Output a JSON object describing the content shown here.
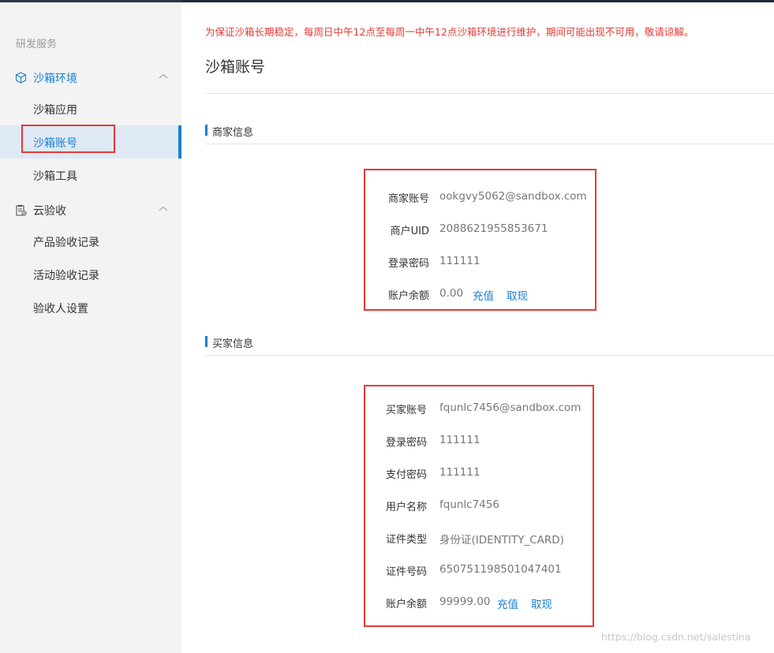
{
  "sidebar": {
    "section_title": "研发服务",
    "groups": [
      {
        "label": "沙箱环境",
        "icon": "cube-icon",
        "items": [
          {
            "label": "沙箱应用"
          },
          {
            "label": "沙箱账号"
          },
          {
            "label": "沙箱工具"
          }
        ]
      },
      {
        "label": "云验收",
        "icon": "clipboard-icon",
        "items": [
          {
            "label": "产品验收记录"
          },
          {
            "label": "活动验收记录"
          },
          {
            "label": "验收人设置"
          }
        ]
      }
    ]
  },
  "main": {
    "notice": "为保证沙箱长期稳定，每周日中午12点至每周一中午12点沙箱环境进行维护，期间可能出现不可用，敬请谅解。",
    "title": "沙箱账号",
    "merchant": {
      "section_title": "商家信息",
      "rows": [
        {
          "label": "商家账号",
          "value": "ookgvy5062@sandbox.com"
        },
        {
          "label": "商户UID",
          "value": "2088621955853671"
        },
        {
          "label": "登录密码",
          "value": "111111"
        },
        {
          "label": "账户余额",
          "value": "0.00",
          "actions": [
            "充值",
            "取现"
          ]
        }
      ]
    },
    "buyer": {
      "section_title": "买家信息",
      "rows": [
        {
          "label": "买家账号",
          "value": "fqunlc7456@sandbox.com"
        },
        {
          "label": "登录密码",
          "value": "111111"
        },
        {
          "label": "支付密码",
          "value": "111111"
        },
        {
          "label": "用户名称",
          "value": "fqunlc7456"
        },
        {
          "label": "证件类型",
          "value": "身份证(IDENTITY_CARD)"
        },
        {
          "label": "证件号码",
          "value": "650751198501047401"
        },
        {
          "label": "账户余额",
          "value": "99999.00",
          "actions": [
            "充值",
            "取现"
          ]
        }
      ]
    }
  },
  "watermark": "https://blog.csdn.net/salestina",
  "colors": {
    "accent": "#1a7fd3",
    "highlight": "#e53935",
    "sidebar_bg": "#f3f3f3",
    "active_bg": "#dfe9f5"
  }
}
